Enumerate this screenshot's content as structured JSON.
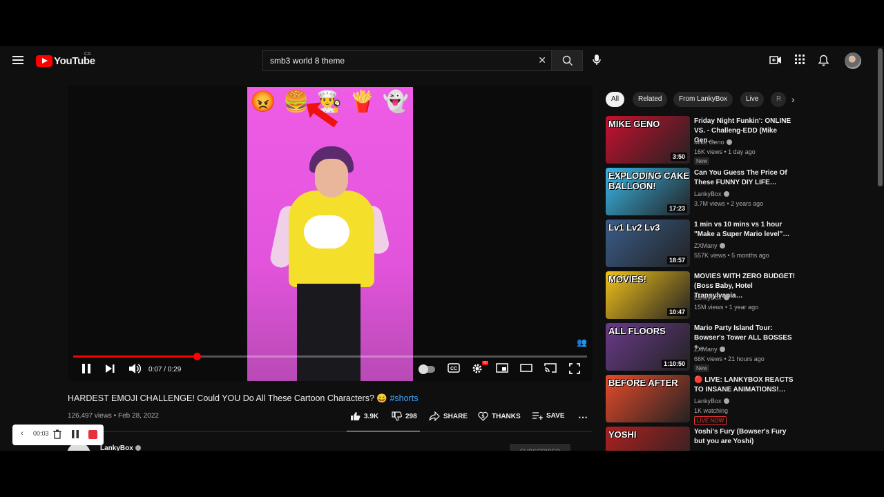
{
  "header": {
    "logo_text": "YouTube",
    "country": "CA",
    "search_value": "smb3 world 8 theme"
  },
  "player": {
    "time": "0:07 / 0:29",
    "progress": 0.24,
    "emojis": [
      "😡",
      "🍔",
      "👨‍🍳",
      "🍟",
      "👻"
    ]
  },
  "video": {
    "title": "HARDEST EMOJI CHALLENGE! Could YOU Do All These Cartoon Characters? 😄",
    "hashtag": "#shorts",
    "views": "126,497 views",
    "date": "Feb 28, 2022",
    "likes": "3.9K",
    "dislikes": "298",
    "share": "SHARE",
    "thanks": "THANKS",
    "save": "SAVE",
    "channel": "LankyBox",
    "subscribe": "SUBSCRIBED"
  },
  "recorder": {
    "time": "00:03"
  },
  "chips": [
    "All",
    "Related",
    "From LankyBox",
    "Live",
    "R"
  ],
  "sidebar": [
    {
      "title": "Friday Night Funkin': ONLINE VS. - Challeng-EDD (Mike Gen…",
      "channel": "Mike Geno",
      "meta": "16K views • 1 day ago",
      "duration": "3:50",
      "badge": "New",
      "thumb_text": "MIKE GENO",
      "thumb_color": "#c8102e"
    },
    {
      "title": "Can You Guess The Price Of These FUNNY DIY LIFE…",
      "channel": "LankyBox",
      "meta": "3.7M views • 2 years ago",
      "duration": "17:23",
      "badge": "",
      "thumb_text": "EXPLODING CAKE BALLOON!",
      "thumb_color": "#39b6e6"
    },
    {
      "title": "1 min vs 10 mins vs 1 hour \"Make a Super Mario level\"…",
      "channel": "ZXMany",
      "meta": "557K views • 5 months ago",
      "duration": "18:57",
      "badge": "",
      "thumb_text": "Lv1 Lv2 Lv3",
      "thumb_color": "#3a5d8a"
    },
    {
      "title": "MOVIES WITH ZERO BUDGET! (Boss Baby, Hotel Transylvania…",
      "channel": "LankyBox",
      "meta": "15M views • 1 year ago",
      "duration": "10:47",
      "badge": "",
      "thumb_text": "MOVIES!",
      "thumb_color": "#f2c21b"
    },
    {
      "title": "Mario Party Island Tour: Bowser's Tower ALL BOSSES +…",
      "channel": "ZXMany",
      "meta": "66K views • 21 hours ago",
      "duration": "1:10:50",
      "badge": "New",
      "thumb_text": "ALL FLOORS",
      "thumb_color": "#6a3a8a"
    },
    {
      "title": "🔴 LIVE: LANKYBOX REACTS TO INSANE ANIMATIONS!…",
      "channel": "LankyBox",
      "meta": "1K watching",
      "duration": "",
      "badge": "LIVE NOW",
      "thumb_text": "BEFORE AFTER",
      "thumb_color": "#e84a2a"
    },
    {
      "title": "Yoshi's Fury (Bowser's Fury but you are Yoshi)",
      "channel": "",
      "meta": "",
      "duration": "",
      "badge": "",
      "thumb_text": "YOSHI",
      "thumb_color": "#b02020"
    }
  ]
}
